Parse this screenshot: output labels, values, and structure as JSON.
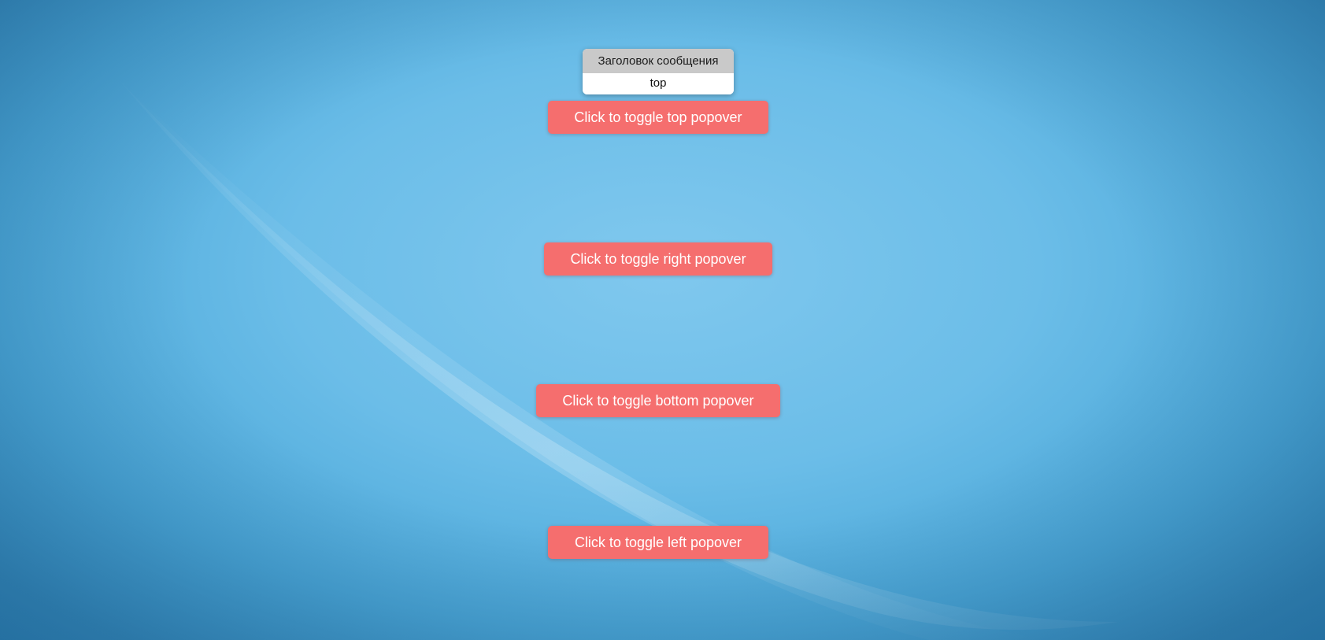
{
  "popover": {
    "title": "Заголовок сообщения",
    "content": "top"
  },
  "buttons": {
    "top": "Click to toggle top popover",
    "right": "Click to toggle right popover",
    "bottom": "Click to toggle bottom popover",
    "left": "Click to toggle left popover"
  },
  "colors": {
    "button_background": "#f56e6e",
    "button_text": "#ffffff",
    "popover_header": "#c9c9c9",
    "desktop_background": "#6bbde8"
  }
}
